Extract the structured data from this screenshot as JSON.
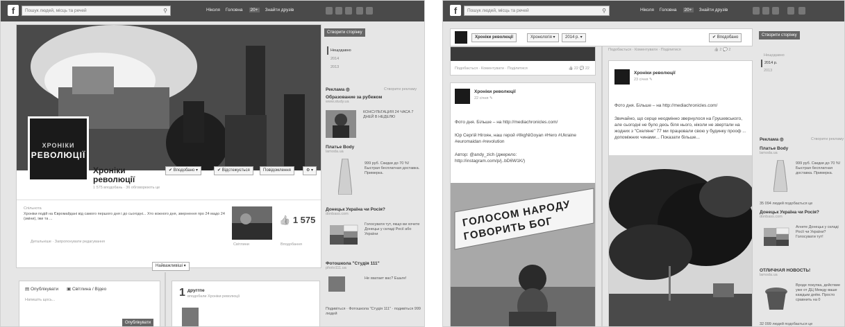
{
  "shotA": {
    "search_placeholder": "Пошук людей, місць та речей",
    "nav": {
      "user": "Ніколя",
      "home": "Головна",
      "home_count": "20+",
      "find_friends": "Знайти друзів"
    },
    "page": {
      "logo_line1": "ХРОНІКИ",
      "logo_line2": "РЕВОЛЮЦІЇ",
      "name_line1": "Хроніки",
      "name_line2": "революції",
      "stats": "1 575 вподобань · 36 обговорюють це",
      "btn_liked": "✔ Вподобано ▾",
      "btn_follow": "✔ Відстежується",
      "btn_message": "Повідомлення",
      "btn_gear": "⚙ ▾",
      "create_page": "Створити сторінку",
      "about_title": "Спільнота",
      "about_text": "Хроніки подій на Євромайдані від самого першого дня і до сьогодні... Хто кожного дня, звернення про 24 мадо 24 (зміни), іжи та ...",
      "about_more": "Детальніше · Запропонувати редагування",
      "photos_label": "Світлини",
      "likes_count": "1 575",
      "likes_label": "Вподобання",
      "timeline_dropdown": "Найважливіші ▾",
      "composer_tab1": "Опублікувати",
      "composer_tab2": "Світлина / Відео",
      "composer_placeholder": "Напишіть щось...",
      "composer_post": "Опублікувати",
      "friends_count": "1",
      "friends_label": "друггпе",
      "friends_sub": "вподобали Хроніки революції"
    },
    "timeline_years": [
      "Нещодавно",
      "2014",
      "2013"
    ],
    "ads_header": "Реклама ◎",
    "ads_create": "Створити рекламу",
    "ads": [
      {
        "title": "Образование за рубежом",
        "site": "www.study.ua",
        "text": "КОНСУЛЬТАЦИЯ 24 ЧАСА 7 ДНЕЙ В НЕДЕЛЮ"
      },
      {
        "title": "Платье Body",
        "site": "lamoda.ua",
        "text": "999 руб. Скидки до 70 %! Быстрая бесплатная доставка. Примерка."
      },
      {
        "title": "Донецьк Україна чи Росія?",
        "site": "donbass.com",
        "text": "Голосувати тут, якщо ви хочете Донецьк у складі Росії або України"
      },
      {
        "title": "Фотошкола \"Студія 111\"",
        "site": "photo111.ua",
        "text": "Не хватает вас? Ешьте!"
      }
    ],
    "ad_footer": "Подивіться · Фотошкола \"Студія 111\" · подивіться 999 людей"
  },
  "shotB": {
    "search_placeholder": "Пошук людей, місць та речей",
    "nav": {
      "user": "Ніколя",
      "home": "Головна",
      "home_count": "20+",
      "find_friends": "Знайти друзів"
    },
    "subbar": {
      "page_name": "Хроніки революції",
      "section": "Хронологія ▾",
      "year": "2014 р. ▾",
      "liked": "✔ Вподобано"
    },
    "create_page": "Створити сторінку",
    "year_nav": [
      "Нещодавно",
      "2014 р.",
      "2013"
    ],
    "top_actions_left": "Подобається · Коментувати · Поділитися",
    "top_actions_right": "Подобається · Коментувати · Поділитися",
    "post_left": {
      "name": "Хроніки революції",
      "time": "22 січня ✎",
      "line1": "Фото дня. Більше – на http://mediachronicles.com/",
      "line2": "Юр Сергій Нігоян, наш герой #IlkgNiGoyan #Hero #Ukraine #euromaidan #revolution",
      "line3": "Автор: @andy_zich (джерело:",
      "line4": "http://instagram.com/p/j..bD6W1K/)",
      "sign_line1": "ГОЛОСОМ НАРОДУ",
      "sign_line2": "ГОВОРИТЬ БОГ"
    },
    "post_right": {
      "name": "Хроніки революції",
      "time": "23 січня ✎",
      "line1": "Фото дня. Більше – на http://mediachronicles.com/",
      "line2": "Звичайно, що серце неодмінно звернулося на Грушевського, але сьогодні не було десь біля нього, ніколи не звертали на жодних з \"Скеляне\" 77 ми працювали свою у будинку прооф ...",
      "line3": "допоміжних чинами... Показати більше..."
    },
    "ads_header": "Реклама ◎",
    "ads_create": "Створити рекламу",
    "ads": [
      {
        "title": "Платье Body",
        "site": "lamoda.ua",
        "text": "999 руб. Скидки до 70 %! Быстрая бесплатная доставка. Примерка."
      },
      {
        "title": "Донецьк Україна чи Росія?",
        "site": "donbass.com",
        "text": "Агнете Донецьк у складі Росії чи України? Голосувати тут!"
      },
      {
        "title": "ОТЛИЧНАЯ НОВОСТЬ!",
        "site": "lamoda.ua",
        "text": "Вроде покупка, действие уже от ДЦ Между ваше каждым днём. Просто сравнить на 0"
      }
    ],
    "ad_footer1": "35 094 людей подобається це",
    "ad_footer2": "32 099 людей подобається це"
  }
}
